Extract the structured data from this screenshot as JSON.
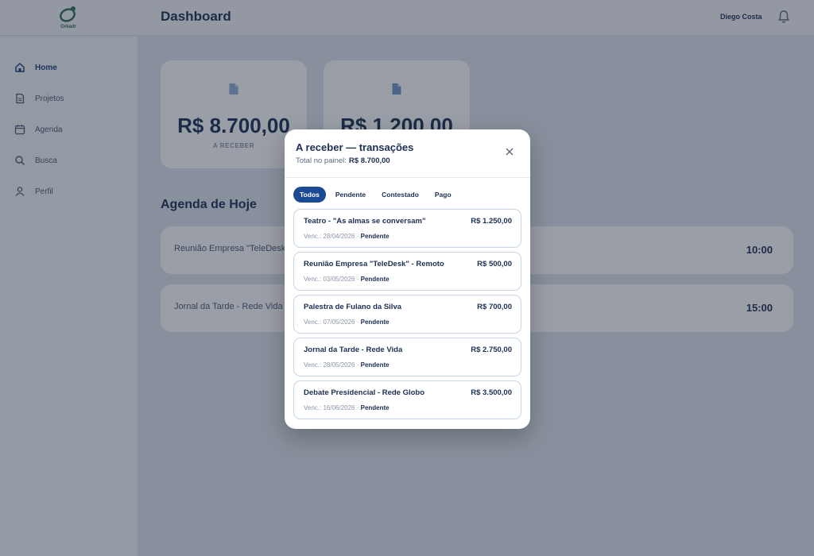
{
  "app": {
    "logo_text": "Orkadr",
    "page_title": "Dashboard",
    "user_name": "Diego Costa"
  },
  "sidebar": {
    "items": [
      {
        "label": "Home",
        "icon": "home-icon",
        "active": true
      },
      {
        "label": "Projetos",
        "icon": "document-icon",
        "active": false
      },
      {
        "label": "Agenda",
        "icon": "calendar-icon",
        "active": false
      },
      {
        "label": "Busca",
        "icon": "search-icon",
        "active": false
      },
      {
        "label": "Perfil",
        "icon": "user-icon",
        "active": false
      }
    ]
  },
  "stats": [
    {
      "value": "R$ 8.700,00",
      "label": "A RECEBER"
    },
    {
      "value": "R$ 1.200,00",
      "label": ""
    }
  ],
  "agenda": {
    "title": "Agenda de Hoje",
    "items": [
      {
        "name": "Reunião Empresa \"TeleDesk\" - Remoto",
        "time": "10:00"
      },
      {
        "name": "Jornal da Tarde - Rede Vida",
        "time": "15:00"
      }
    ]
  },
  "modal": {
    "title": "A receber — transações",
    "subtitle_label": "Total no painel:",
    "subtitle_total": "R$ 8.700,00",
    "tabs": [
      {
        "label": "Todos",
        "active": true
      },
      {
        "label": "Pendente",
        "active": false
      },
      {
        "label": "Contestado",
        "active": false
      },
      {
        "label": "Pago",
        "active": false
      }
    ],
    "transactions": [
      {
        "title": "Teatro - \"As almas se conversam\"",
        "amount": "R$ 1.250,00",
        "due": "Venc.: 28/04/2026",
        "status": "Pendente"
      },
      {
        "title": "Reunião Empresa \"TeleDesk\" - Remoto",
        "amount": "R$ 500,00",
        "due": "Venc.: 03/05/2026",
        "status": "Pendente"
      },
      {
        "title": "Palestra de Fulano da Silva",
        "amount": "R$ 700,00",
        "due": "Venc.: 07/05/2026",
        "status": "Pendente"
      },
      {
        "title": "Jornal da Tarde - Rede Vida",
        "amount": "R$ 2.750,00",
        "due": "Venc.: 28/05/2026",
        "status": "Pendente"
      },
      {
        "title": "Debate Presidencial - Rede Globo",
        "amount": "R$ 3.500,00",
        "due": "Venc.: 16/06/2026",
        "status": "Pendente"
      }
    ]
  },
  "colors": {
    "primary": "#1b4a95",
    "text_dark": "#1b2f52",
    "background": "#dfe6ef",
    "brand_green": "#2f6e53"
  }
}
